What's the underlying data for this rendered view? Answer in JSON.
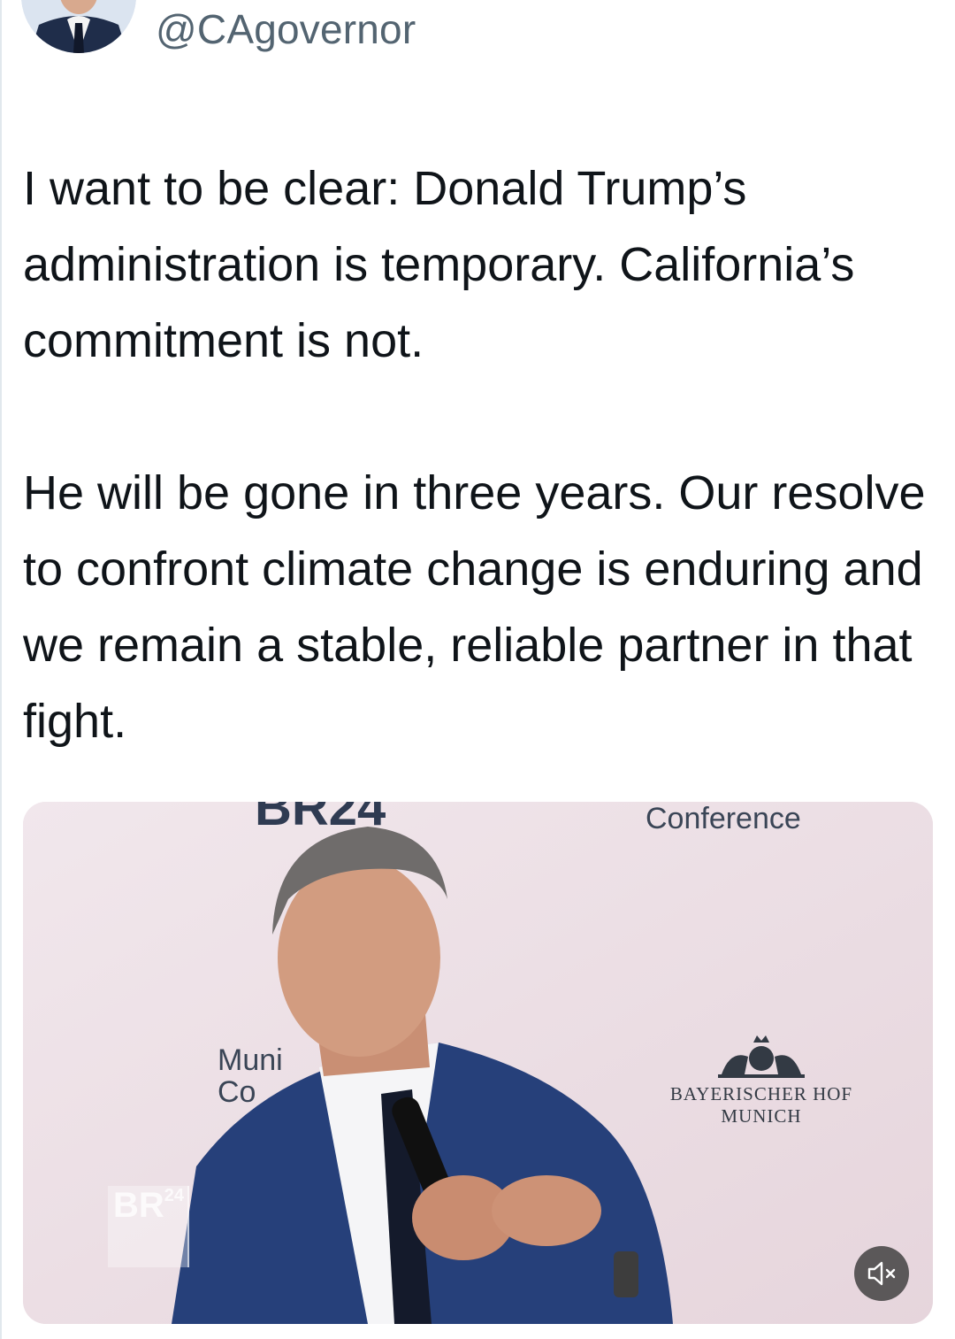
{
  "tweet": {
    "handle": "@CAgovernor",
    "paragraphs": [
      "I want to be clear: Donald Trump’s administration is temporary. California’s commitment is not.",
      "He will be gone in three years. Our resolve to confront climate change is enduring and we remain a stable, reliable partner in that fight."
    ]
  },
  "video": {
    "backdrop_top_text": "BR24",
    "backdrop_right_text": "Conference",
    "backdrop_left_text_line1": "Muni",
    "backdrop_left_text_line2": "Co",
    "hotel_logo_line1": "BAYERISCHER HOF",
    "hotel_logo_line2": "MUNICH",
    "broadcaster_bug": "BR",
    "broadcaster_bug_num": "24",
    "mute_icon": "speaker-muted-icon"
  }
}
